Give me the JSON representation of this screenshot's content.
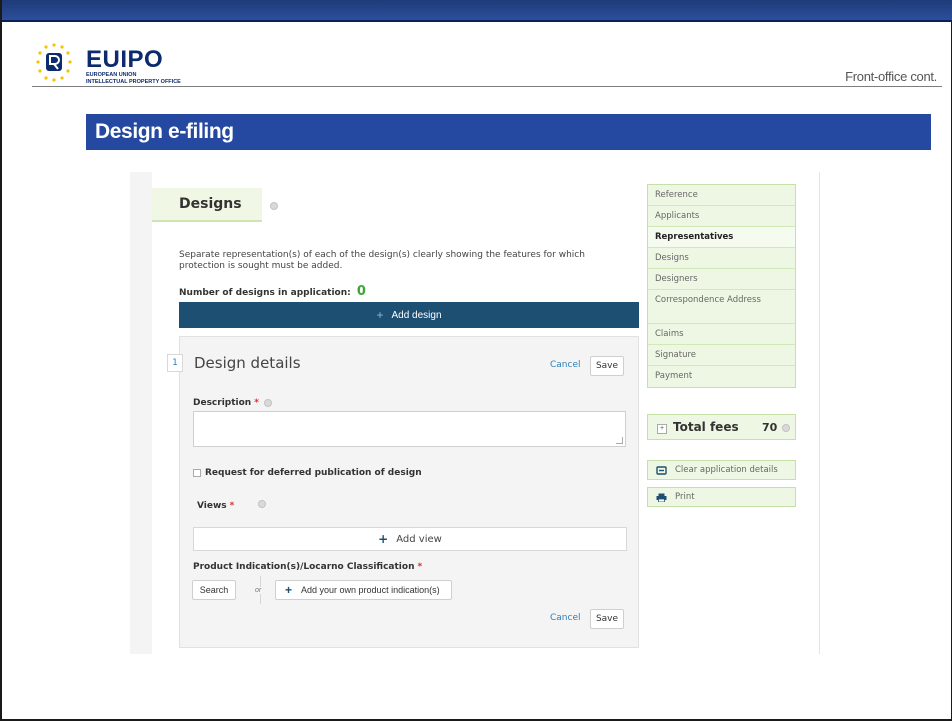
{
  "header": {
    "logo_word": "EUIPO",
    "logo_sub_line1": "EUROPEAN UNION",
    "logo_sub_line2": "INTELLECTUAL PROPERTY OFFICE",
    "section_label": "Front-office cont."
  },
  "slide_title": "Design e-filing",
  "form": {
    "tab_title": "Designs",
    "intro_text": "Separate representation(s) of each of the design(s) clearly showing the features for which protection is sought must be added.",
    "count_label": "Number of designs in application:",
    "count_value": "0",
    "add_design_label": "Add design",
    "details": {
      "index": "1",
      "title": "Design details",
      "cancel_label": "Cancel",
      "save_label": "Save",
      "description_label": "Description",
      "required_mark": "*",
      "deferred_label": "Request for deferred publication of design",
      "views_label": "Views",
      "add_view_label": "Add view",
      "product_label": "Product Indication(s)/Locarno Classification",
      "search_label": "Search",
      "or_label": "or",
      "own_product_label": "Add your own product indication(s)"
    }
  },
  "nav": {
    "items": [
      {
        "label": "Reference",
        "active": false
      },
      {
        "label": "Applicants",
        "active": false
      },
      {
        "label": "Representatives",
        "active": true
      },
      {
        "label": "Designs",
        "active": false
      },
      {
        "label": "Designers",
        "active": false
      },
      {
        "label": "Correspondence Address",
        "active": false
      },
      {
        "label": "Claims",
        "active": false
      },
      {
        "label": "Signature",
        "active": false
      },
      {
        "label": "Payment",
        "active": false
      }
    ]
  },
  "fees": {
    "toggle": "+",
    "label": "Total fees",
    "value": "70"
  },
  "actions": {
    "clear_label": "Clear application details",
    "print_label": "Print"
  },
  "colors": {
    "title_bar": "#2549a0",
    "top_bar": "#1e3a78",
    "add_design_bg": "#1d4f73",
    "nav_bg": "#eef7e4",
    "count_green": "#3fa535",
    "required_red": "#d9302c",
    "link_blue": "#2f7fb8"
  },
  "icons": [
    "eu-stars-logo-icon",
    "info-icon",
    "plus-icon",
    "clear-icon",
    "print-icon"
  ]
}
